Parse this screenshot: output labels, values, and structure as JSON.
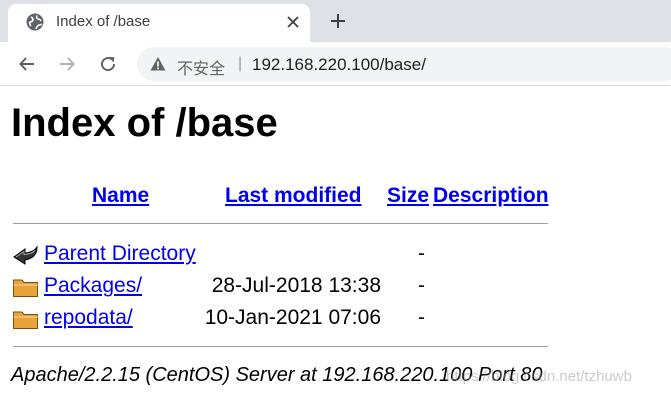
{
  "browser": {
    "tab_title": "Index of /base",
    "security_label": "不安全",
    "separator": "|",
    "url": "192.168.220.100/base/"
  },
  "page": {
    "title": "Index of /base",
    "columns": {
      "name": "Name",
      "last_modified": "Last modified",
      "size": "Size",
      "description": "Description"
    },
    "rows": [
      {
        "name": "Parent Directory",
        "date": "",
        "size": "-",
        "icon": "back-icon"
      },
      {
        "name": "Packages/",
        "date": "28-Jul-2018 13:38",
        "size": "-",
        "icon": "folder-icon"
      },
      {
        "name": "repodata/",
        "date": "10-Jan-2021 07:06",
        "size": "-",
        "icon": "folder-icon"
      }
    ],
    "address": "Apache/2.2.15 (CentOS) Server at 192.168.220.100 Port 80",
    "watermark": "https://blog.csdn.net/tzhuwb"
  },
  "colors": {
    "link": "#0000ee",
    "tabstrip": "#dee1e6",
    "omnibox": "#f1f3f4",
    "folder": "#e8a33c"
  }
}
